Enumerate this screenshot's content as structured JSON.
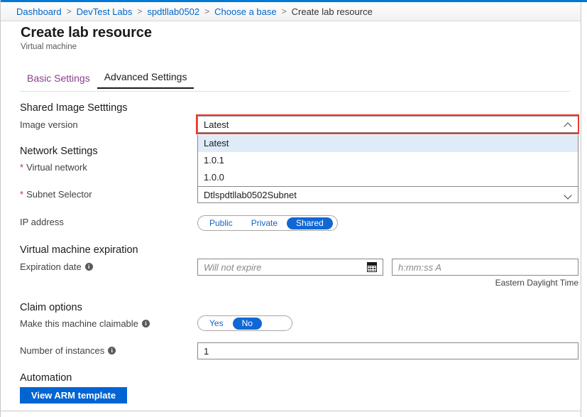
{
  "window": {
    "accent_color": "#0078d4",
    "border_color": "#c8c8c8"
  },
  "breadcrumb": {
    "separator": ">",
    "items": [
      {
        "label": "Dashboard",
        "current": false
      },
      {
        "label": "DevTest Labs",
        "current": false
      },
      {
        "label": "spdtllab0502",
        "current": false
      },
      {
        "label": "Choose a base",
        "current": false
      },
      {
        "label": "Create lab resource",
        "current": true
      }
    ]
  },
  "header": {
    "title": "Create lab resource",
    "subtitle": "Virtual machine"
  },
  "tabs": [
    {
      "label": "Basic Settings",
      "state": "visited"
    },
    {
      "label": "Advanced Settings",
      "state": "active"
    }
  ],
  "sections": {
    "shared_image": {
      "heading": "Shared Image Setttings",
      "image_version": {
        "label": "Image version",
        "value": "Latest",
        "expanded": true,
        "chevron": "chevron-up-icon",
        "options": [
          {
            "label": "Latest",
            "selected": true
          },
          {
            "label": "1.0.1",
            "selected": false
          },
          {
            "label": "1.0.0",
            "selected": false
          }
        ],
        "highlight_color": "#e8392e"
      }
    },
    "network": {
      "heading": "Network Settings",
      "virtual_network": {
        "label": "Virtual network",
        "required": true,
        "required_marker": "*",
        "value": ""
      },
      "subnet_selector": {
        "label": "Subnet Selector",
        "required": true,
        "required_marker": "*",
        "value": "Dtlspdtllab0502Subnet",
        "chevron": "chevron-down-icon"
      },
      "ip_address": {
        "label": "IP address",
        "options": [
          "Public",
          "Private",
          "Shared"
        ],
        "selected": "Shared",
        "accent_color": "#1268d3"
      }
    },
    "expiration": {
      "heading": "Virtual machine expiration",
      "expiration_date": {
        "label": "Expiration date",
        "info": "i",
        "date_value": "",
        "date_placeholder": "Will not expire",
        "calendar_icon": "calendar-icon",
        "time_value": "",
        "time_placeholder": "h:mm:ss A"
      },
      "timezone_note": "Eastern Daylight Time"
    },
    "claim": {
      "heading": "Claim options",
      "claimable": {
        "label": "Make this machine claimable",
        "info": "i",
        "options": [
          "Yes",
          "No"
        ],
        "selected": "No"
      },
      "instances": {
        "label": "Number of instances",
        "info": "i",
        "value": "1"
      }
    },
    "automation": {
      "heading": "Automation",
      "view_arm_template_button": "View ARM template",
      "button_color": "#0064d2"
    }
  }
}
